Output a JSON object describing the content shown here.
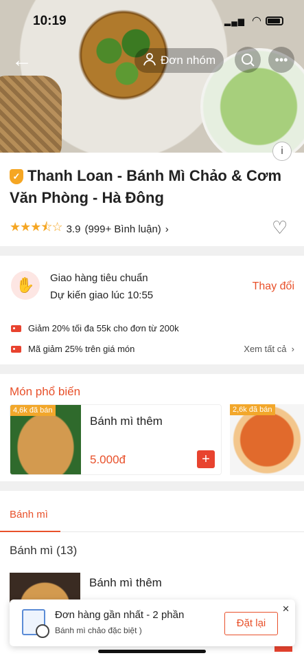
{
  "status": {
    "time": "10:19"
  },
  "header": {
    "group_label": "Đơn nhóm",
    "back_icon": "back-arrow-icon",
    "more_icon": "more-icon"
  },
  "store": {
    "name": "Thanh Loan - Bánh Mì Chảo & Cơm Văn Phòng - Hà Đông",
    "rating": "3.9",
    "review_count": "(999+ Bình luận)",
    "stars": "★★★⯪☆"
  },
  "delivery": {
    "title": "Giao hàng tiêu chuẩn",
    "eta": "Dự kiến giao lúc 10:55",
    "change_label": "Thay đổi"
  },
  "promos": [
    "Giảm 20% tối đa 55k cho đơn từ 200k",
    "Mã giảm 25% trên giá món"
  ],
  "see_all": "Xem tất cả",
  "popular": {
    "title": "Món phổ biến",
    "items": [
      {
        "sold": "4,6k đã bán",
        "name": "Bánh mì thêm",
        "price": "5.000đ"
      },
      {
        "sold": "2,6k đã bán"
      }
    ]
  },
  "tabs": {
    "active": "Bánh mì"
  },
  "category": {
    "title": "Bánh mì (13)",
    "item_name": "Bánh mì thêm"
  },
  "toast": {
    "title": "Đơn hàng gần nhất - 2 phần",
    "subtitle": "Bánh mì chảo đặc biệt )",
    "reorder_label": "Đặt lại"
  },
  "colors": {
    "accent": "#e8502a",
    "star": "#f5a623",
    "sold_badge": "#f2a72b"
  }
}
